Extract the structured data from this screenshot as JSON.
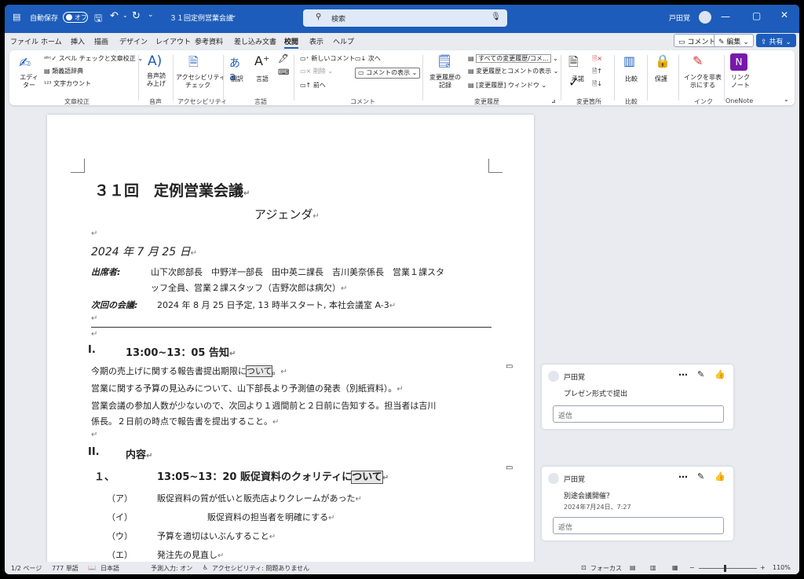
{
  "titlebar": {
    "autosave_label": "自動保存",
    "autosave_state": "オフ",
    "doc_title": "３１回定例営業会議",
    "search_placeholder": "検索",
    "user_name": "戸田覚",
    "accent": "#1d5cba"
  },
  "menu": {
    "tabs": [
      "ファイル",
      "ホーム",
      "挿入",
      "描画",
      "デザイン",
      "レイアウト",
      "参考資料",
      "差し込み文書",
      "校閲",
      "表示",
      "ヘルプ"
    ],
    "active_tab": "校閲",
    "comment_btn": "コメント",
    "edit_btn": "編集",
    "share_btn": "共有"
  },
  "ribbon": {
    "editor": "エディ\nター",
    "spell": "スペル チェックと文章校正",
    "thesaurus": "類義語辞典",
    "wordcount": "文字カウント",
    "g_proof": "文章校正",
    "readaloud": "音声読\nみ上げ",
    "g_voice": "音声",
    "access": "アクセシビリティ\nチェック",
    "g_access": "アクセシビリティ",
    "translate": "翻訳",
    "language": "言語",
    "g_lang": "言語",
    "new_comment": "新しいコメント",
    "delete": "削除",
    "prev": "前へ",
    "next": "次へ",
    "show_comments": "コメントの表示",
    "g_comment": "コメント",
    "track": "変更履歴の\n記録",
    "all_markup": "すべての変更履歴/コメ...",
    "show_markup": "変更履歴とコメントの表示",
    "pane": "[変更履歴] ウィンドウ",
    "g_track": "変更履歴",
    "accept": "承諾",
    "g_changes": "変更箇所",
    "compare": "比較",
    "g_compare": "比較",
    "protect": "保護",
    "hide_ink": "インクを非表\n示にする",
    "g_ink": "インク",
    "link_note": "リンク\nノート",
    "g_onenote": "OneNote"
  },
  "doc": {
    "title": "３１回　定例営業会議",
    "subtitle": "アジェンダ",
    "date": "2024 年 7 月 25 日",
    "attendees_label": "出席者:",
    "attendees_1": "山下次郎部長　中野洋一部長　田中英二課長　吉川美奈係長　営業１課スタ",
    "attendees_2": "ッフ全員、営業２課スタッフ（吉野次郎は病欠）",
    "next_label": "次回の会議:",
    "next_text": "2024 年 8 月 25 日予定, 13 時半スタート, 本社会議室 A-3",
    "sec1_num": "I.",
    "sec1_title": "13:00~13：05 告知",
    "p1_a": "今期の売上げに関する報告書提出期限に",
    "p1_hl": "ついて",
    "p1_b": "。",
    "p2": "営業に関する予算の見込みについて、山下部長より予測値の発表（別紙資料）。",
    "p3": "営業会議の参加人数が少ないので、次回より１週間前と２日前に告知する。担当者は吉川",
    "p4": "係長。２日前の時点で報告書を提出すること。",
    "sec2_num": "II.",
    "sec2_title": "内容",
    "item1_num": "１、",
    "item1_a": "13:05~13：20 販促資料のクォリティに",
    "item1_hl": "ついて",
    "sub_a_label": "（ア）",
    "sub_a": "販促資料の質が低いと販売店よりクレームがあった",
    "sub_b_label": "（イ）",
    "sub_b": "販促資料の担当者を明確にする",
    "sub_c_label": "（ウ）",
    "sub_c": "予算を適切はいぶんすること",
    "sub_d_label": "（エ）",
    "sub_d": "発注先の見直し"
  },
  "comments": [
    {
      "author": "戸田覚",
      "text": "プレゼン形式で提出",
      "date": "",
      "reply": "返信"
    },
    {
      "author": "戸田覚",
      "text": "別途会議開催？",
      "date": "2024年7月24日、7:27",
      "reply": "返信"
    }
  ],
  "status": {
    "page": "1/2 ページ",
    "words": "777 単語",
    "lang": "日本語",
    "predict": "予測入力: オン",
    "access": "アクセシビリティ: 問題ありません",
    "focus": "フォーカス",
    "zoom": "110%"
  }
}
